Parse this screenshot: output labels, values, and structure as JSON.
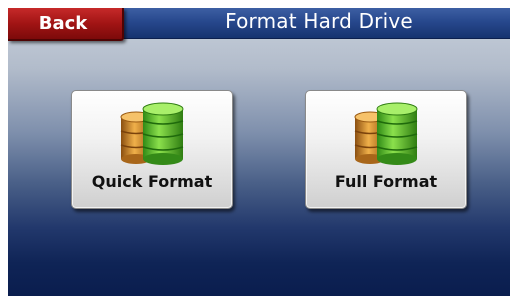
{
  "header": {
    "title": "Format Hard Drive",
    "back_label": "Back"
  },
  "options": [
    {
      "label": "Quick Format",
      "icon": "database-stack-icon"
    },
    {
      "label": "Full Format",
      "icon": "database-stack-icon"
    }
  ],
  "colors": {
    "title_bar": "#27488d",
    "back_button": "#a11414",
    "cylinder_front": "#57c12d",
    "cylinder_back": "#d78f22"
  }
}
